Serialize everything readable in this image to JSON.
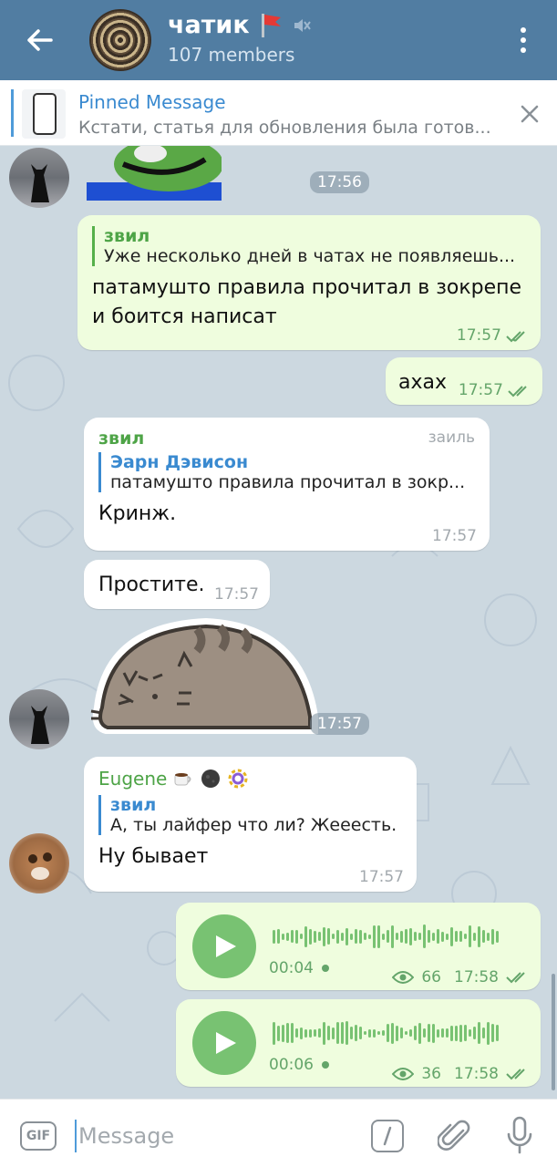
{
  "header": {
    "title": "чатик",
    "subtitle": "107 members"
  },
  "pinned": {
    "title": "Pinned Message",
    "text": "Кстати, статья для обновления была готов..."
  },
  "messages": {
    "sticker_pepe_time": "17:56",
    "m1": {
      "reply_name": "звил",
      "reply_text": "Уже несколько дней в чатах не появляешь...",
      "text_line1": "патамушто правила прочитал в зокрепе",
      "text_line2": "и боится написат",
      "time": "17:57"
    },
    "m2": {
      "text": "ахах",
      "time": "17:57"
    },
    "m3": {
      "sender": "звил",
      "sender_title": "заиль",
      "reply_name": "Эарн Дэвисон",
      "reply_text": "патамушто правила прочитал в зокр...",
      "text": "Кринж.",
      "time": "17:57"
    },
    "m4": {
      "text": "Простите.",
      "time": "17:57"
    },
    "sticker_cat_time": "17:57",
    "m5": {
      "sender": "Eugene",
      "reply_name": "звил",
      "reply_text": "А, ты лайфер что ли? Жееесть.",
      "text": "Ну бывает",
      "time": "17:57"
    },
    "v1": {
      "duration": "00:04",
      "views": "66",
      "time": "17:58"
    },
    "v2": {
      "duration": "00:06",
      "views": "36",
      "time": "17:58"
    }
  },
  "input": {
    "gif_label": "GIF",
    "placeholder": "Message"
  },
  "colors": {
    "header": "#517da2",
    "out_bubble": "#effdde",
    "in_bubble": "#ffffff",
    "accent_green": "#4ea447",
    "accent_blue": "#3a8ad0"
  }
}
